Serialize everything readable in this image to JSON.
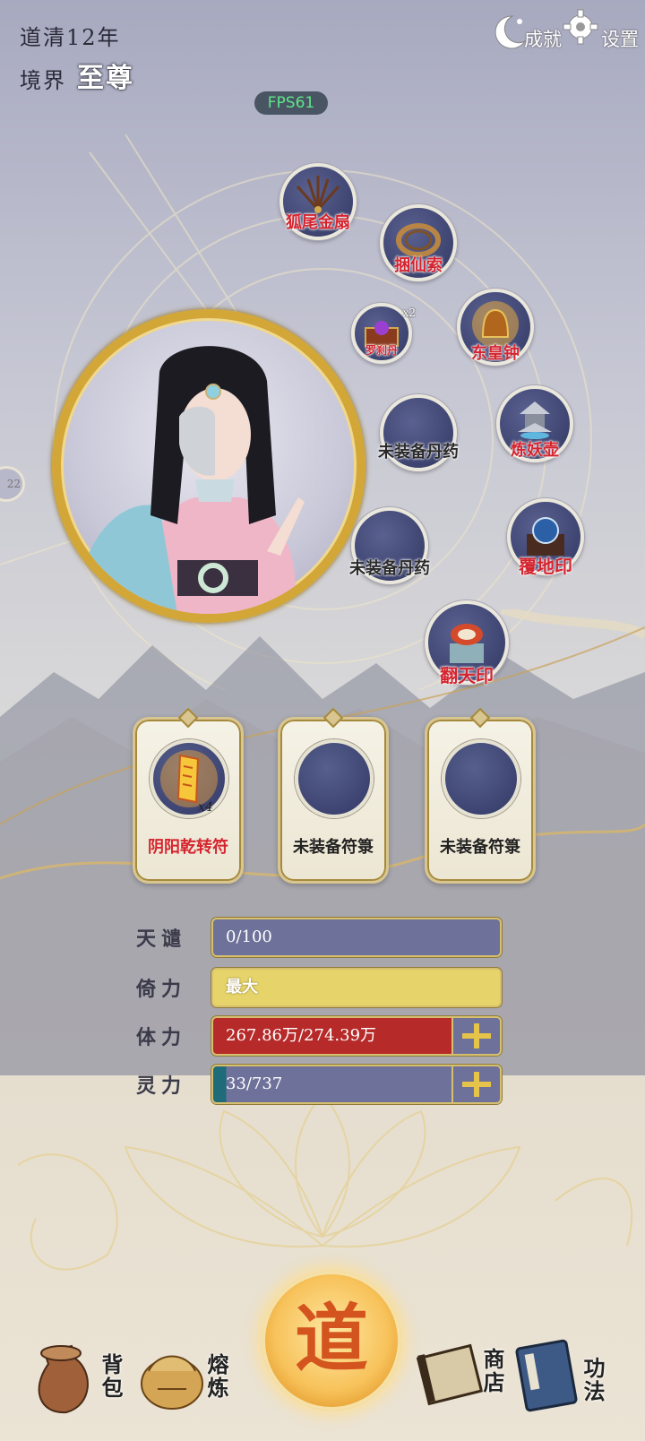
{
  "header": {
    "era": "道清12年",
    "realm_label": "境界",
    "realm_value": "至尊",
    "fps": "FPS61",
    "achievements_label": "成就",
    "settings_label": "设置",
    "side_tab": "22"
  },
  "treasures": [
    {
      "label": "狐尾金扇",
      "icon": "fan-icon",
      "equipped": true
    },
    {
      "label": "捆仙索",
      "icon": "rope-icon",
      "equipped": true
    },
    {
      "label": "罗刹丹",
      "icon": "chest-icon",
      "equipped": true,
      "count": "x2"
    },
    {
      "label": "东皇钟",
      "icon": "bell-icon",
      "equipped": true
    },
    {
      "label": "未装备丹药",
      "icon": "",
      "equipped": false
    },
    {
      "label": "炼妖壶",
      "icon": "pagoda-icon",
      "equipped": true
    },
    {
      "label": "未装备丹药",
      "icon": "",
      "equipped": false
    },
    {
      "label": "覆地印",
      "icon": "orb-seal-icon",
      "equipped": true
    },
    {
      "label": "翻天印",
      "icon": "seal-icon",
      "equipped": true
    }
  ],
  "talismans": [
    {
      "label": "阴阳乾转符",
      "count": "x4",
      "equipped": true
    },
    {
      "label": "未装备符箓",
      "equipped": false
    },
    {
      "label": "未装备符箓",
      "equipped": false
    }
  ],
  "stats": [
    {
      "label": "天谴",
      "value": "0/100",
      "fill": 0.0,
      "color": "#6e7199"
    },
    {
      "label": "倚力",
      "value": "最大",
      "fill": 1.0,
      "color": "#e6d46a"
    },
    {
      "label": "体力",
      "value": "267.86万/274.39万",
      "fill": 0.976,
      "color": "#b72a2a"
    },
    {
      "label": "灵力",
      "value": "33/737",
      "fill": 0.045,
      "color": "#1f6b7a"
    }
  ],
  "nav": {
    "bag": "背包",
    "forge": "熔炼",
    "dao": "道",
    "shop": "商店",
    "skills": "功法"
  }
}
